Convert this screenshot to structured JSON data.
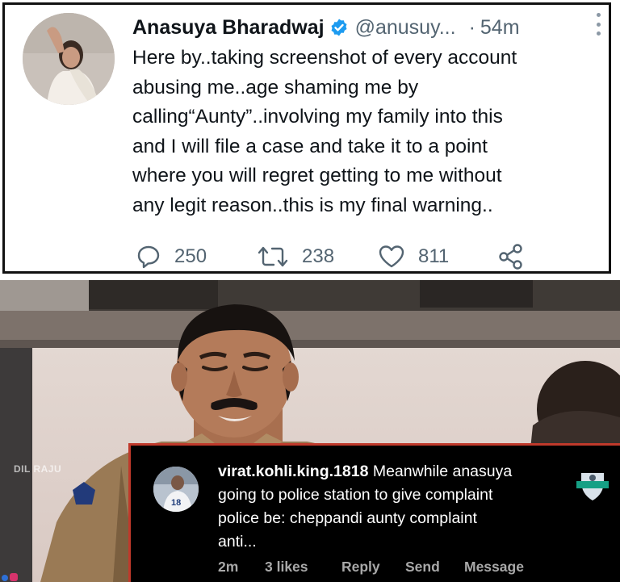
{
  "tweet": {
    "author_name": "Anasuya Bharadwaj",
    "handle": "@anusuy...",
    "time_sep": "·",
    "time": "54m",
    "text_lines": [
      "Here by..taking screenshot of every account",
      "abusing me..age shaming me by",
      "calling“Aunty”..involving my family into this",
      "and I will file a case and take it to a point",
      "where you will regret getting to me without",
      "any legit reason..this is my final warning.."
    ],
    "replies": "250",
    "retweets": "238",
    "likes": "811",
    "icons": {
      "verified": "verified-badge-icon",
      "reply": "reply-icon",
      "retweet": "retweet-icon",
      "like": "heart-icon",
      "share": "share-icon",
      "more": "more-vertical-icon"
    },
    "colors": {
      "verified": "#1d9bf0",
      "muted": "#536471"
    }
  },
  "scene": {
    "watermark": "DIL RAJU"
  },
  "comment": {
    "username": "virat.kohli.king.1818",
    "text_line_1": " Meanwhile anasuya",
    "text_lines": [
      "going to police station to give complaint",
      "police be: cheppandi aunty complaint",
      "anti..."
    ],
    "time": "2m",
    "likes": "3 likes",
    "reply": "Reply",
    "send": "Send",
    "message": "Message",
    "avatar_number": "18",
    "colors": {
      "border": "#c0392b",
      "muted": "#a8a8a8"
    }
  }
}
